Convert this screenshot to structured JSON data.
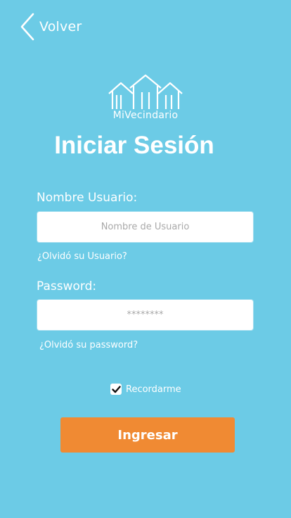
{
  "header": {
    "back_label": "Volver",
    "back_icon": "chevron-left-icon"
  },
  "logo": {
    "icon": "houses-icon",
    "text": "MiVecindario"
  },
  "title": "Iniciar Sesión",
  "form": {
    "username": {
      "label": "Nombre Usuario:",
      "placeholder": "Nombre de Usuario",
      "value": "",
      "forgot_link": "¿Olvidó su Usuario?"
    },
    "password": {
      "label": "Password:",
      "placeholder": "********",
      "value": "",
      "forgot_link": "¿Olvidó su password?"
    },
    "remember": {
      "label": "Recordarme",
      "checked": true
    },
    "submit_label": "Ingresar"
  },
  "colors": {
    "background": "#6ccbe6",
    "primary_button": "#f08a33",
    "text": "#ffffff"
  }
}
